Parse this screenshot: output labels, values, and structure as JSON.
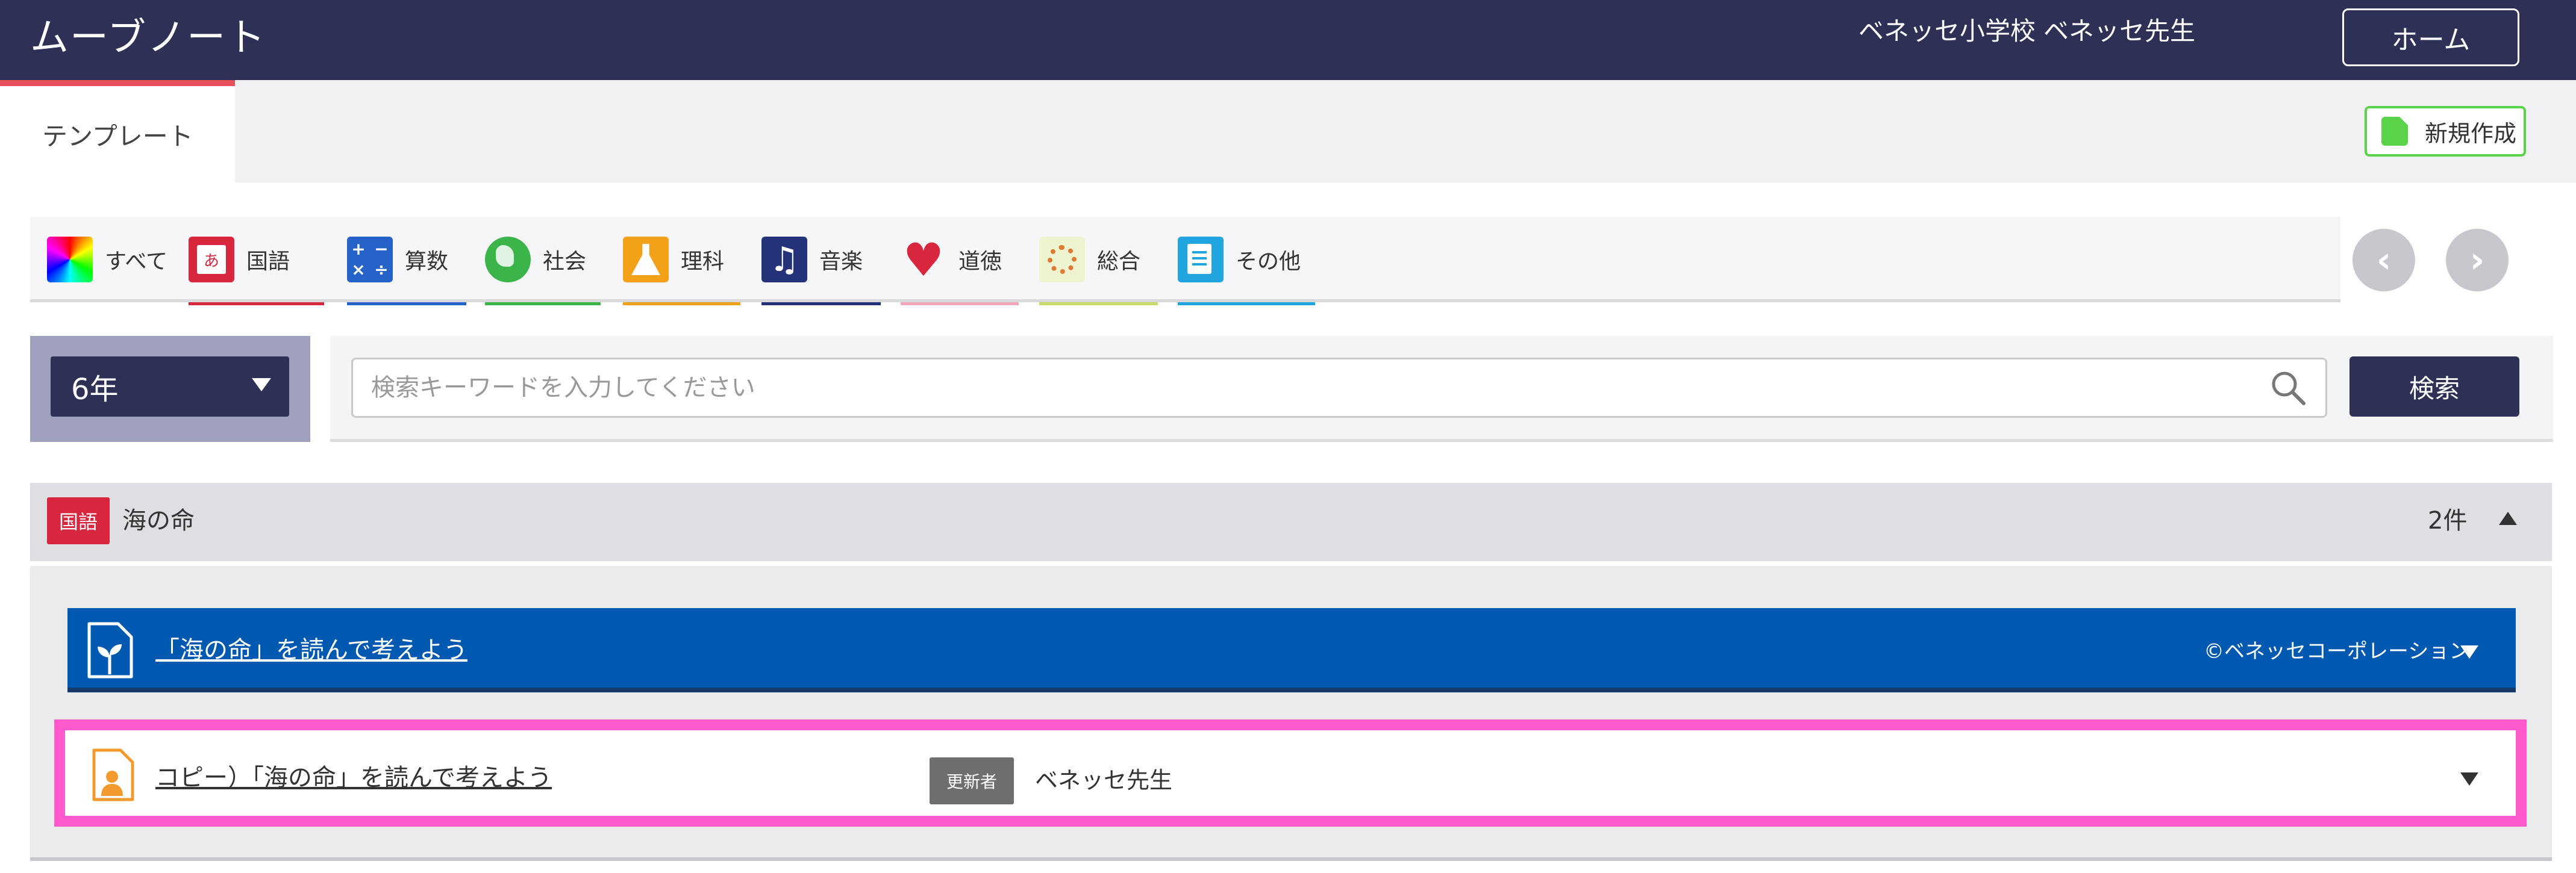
{
  "header": {
    "app_title": "ムーブノート",
    "school": "ベネッセ小学校",
    "teacher": "ベネッセ先生",
    "home_label": "ホーム"
  },
  "tabs": {
    "template_label": "テンプレート",
    "new_label": "新規作成"
  },
  "subjects": [
    {
      "label": "すべて",
      "icon": "all-icon",
      "color": "#ffffff"
    },
    {
      "label": "国語",
      "icon": "japanese-icon",
      "color": "#d9263f"
    },
    {
      "label": "算数",
      "icon": "math-icon",
      "color": "#2563c9"
    },
    {
      "label": "社会",
      "icon": "globe-icon",
      "color": "#3bb54a"
    },
    {
      "label": "理科",
      "icon": "flask-icon",
      "color": "#f4a11a"
    },
    {
      "label": "音楽",
      "icon": "music-icon",
      "color": "#24327a"
    },
    {
      "label": "道徳",
      "icon": "heart-icon",
      "color": "#f3a7bb"
    },
    {
      "label": "総合",
      "icon": "flower-icon",
      "color": "#c5d86a"
    },
    {
      "label": "その他",
      "icon": "notebook-icon",
      "color": "#20a5e0"
    }
  ],
  "search": {
    "grade": "6年",
    "placeholder": "検索キーワードを入力してください",
    "button_label": "検索"
  },
  "group": {
    "badge": "国語",
    "title": "海の命",
    "count": "2件",
    "items": [
      {
        "title": "「海の命」を読んで考えよう",
        "copyright": "©ベネッセコーポレーション"
      },
      {
        "title": "コピー）「海の命」を読んで考えよう",
        "updater_badge": "更新者",
        "updater": "ベネッセ先生"
      }
    ]
  },
  "colors": {
    "header_bg": "#2e3055",
    "accent_red": "#e8505b",
    "item_blue": "#0059b0",
    "highlight_pink": "#ff5acb",
    "new_green": "#5ad34a"
  }
}
